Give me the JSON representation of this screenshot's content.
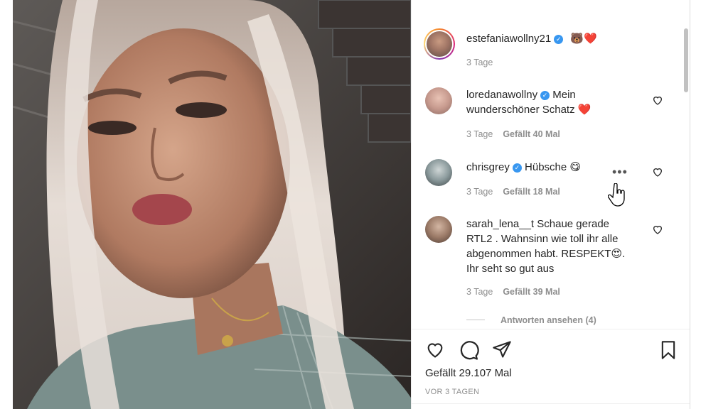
{
  "post": {
    "author": "estefaniawollny21",
    "author_emojis": "🐻❤️",
    "author_time": "3 Tage"
  },
  "comments": [
    {
      "user": "loredanawollny",
      "text_line1": "Mein",
      "text_line2": "wunderschöner Schatz",
      "emoji": "❤️",
      "time": "3 Tage",
      "likes": "Gefällt 40 Mal"
    },
    {
      "user": "chrisgrey",
      "text_line1": "Hübsche",
      "emoji": "😋",
      "time": "3 Tage",
      "likes": "Gefällt 18 Mal"
    },
    {
      "user": "sarah_lena__t",
      "text_line1": "Schaue gerade",
      "text_line2": "RTL2 . Wahnsinn wie toll ihr alle",
      "text_line3": "abgenommen habt. RESPEKT",
      "text_line3_tail": ".",
      "emoji": "😍",
      "text_line4": "Ihr seht so gut aus",
      "time": "3 Tage",
      "likes": "Gefällt 39 Mal",
      "replies": "Antworten ansehen (4)"
    }
  ],
  "footer": {
    "likes": "Gefällt 29.107 Mal",
    "ago": "VOR 3 TAGEN"
  },
  "icons": {
    "like": "heart-icon",
    "comment": "comment-icon",
    "share": "paper-plane-icon",
    "save": "bookmark-icon",
    "more": "ellipsis-icon",
    "cursor": "hand-cursor-icon"
  },
  "colors": {
    "verified": "#3897f0",
    "text": "#262626",
    "secondary": "#8e8e8e"
  }
}
